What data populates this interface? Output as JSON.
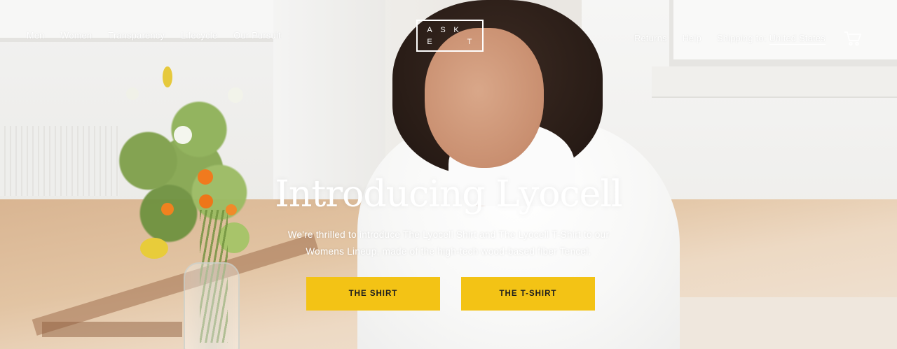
{
  "brand": {
    "logo_letters": [
      "A",
      "S",
      "K",
      "",
      "E",
      "",
      "",
      "T"
    ]
  },
  "nav": {
    "left": [
      {
        "label": "Men"
      },
      {
        "label": "Women"
      },
      {
        "label": "Transparency"
      },
      {
        "label": "Lifecycle"
      },
      {
        "label": "Our Pursuit"
      }
    ],
    "returns_label": "Returns",
    "help_label": "Help",
    "shipping_prefix": "Shipping to:",
    "shipping_country": "United States",
    "cart_icon": "shopping-cart-icon"
  },
  "hero": {
    "title": "Introducing Lyocell",
    "subtitle_line1": "We're thrilled to introduce The Lyocell Shirt and The Lyocell T-Shirt to our",
    "subtitle_line2": "Womens Lineup, made of the high-tech wood-based fiber Tencel.",
    "cta_shirt": "THE SHIRT",
    "cta_tshirt": "THE T-SHIRT"
  },
  "colors": {
    "cta_background": "#f3c315",
    "cta_text": "#1d1d1d",
    "nav_text": "#ffffff"
  }
}
